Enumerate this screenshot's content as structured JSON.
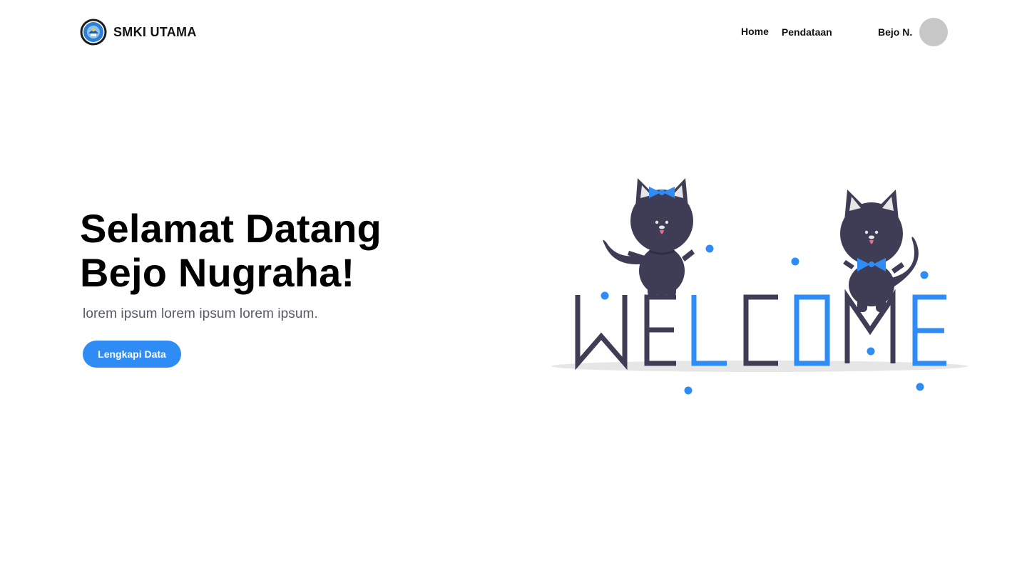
{
  "brand": {
    "name": "SMKI UTAMA",
    "logo_icon": "school-emblem-icon"
  },
  "nav": {
    "items": [
      {
        "label": "Home"
      },
      {
        "label": "Pendataan"
      }
    ]
  },
  "user": {
    "name": "Bejo N.",
    "avatar_icon": "user-avatar-placeholder"
  },
  "hero": {
    "title_line1": "Selamat Datang",
    "title_line2": "Bejo Nugraha!",
    "subtitle": "lorem ipsum lorem ipsum lorem ipsum.",
    "cta_label": "Lengkapi Data"
  },
  "illustration": {
    "word": "WELCOME",
    "colors": {
      "dark": "#3f3d56",
      "accent": "#2f8cf4",
      "shadow": "#e6e6e6"
    }
  },
  "colors": {
    "accent": "#2f8cf4",
    "text": "#000000",
    "muted": "#555a66",
    "avatar": "#c7c7c7"
  }
}
